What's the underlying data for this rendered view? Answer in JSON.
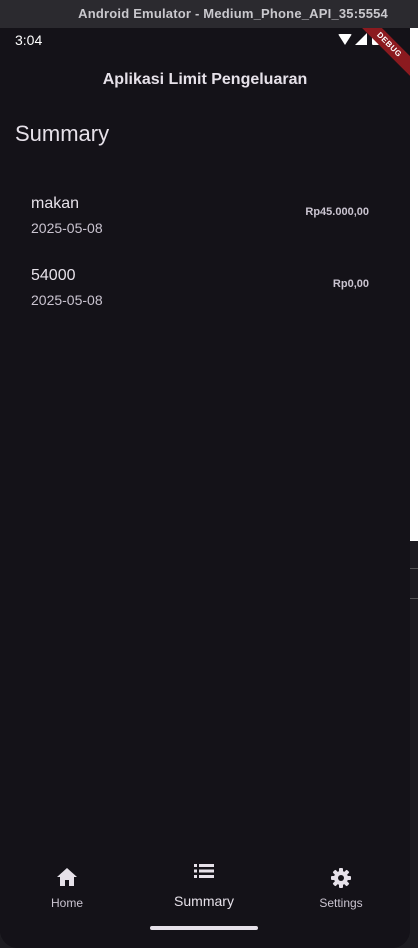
{
  "window": {
    "title": "Android Emulator - Medium_Phone_API_35:5554"
  },
  "status_bar": {
    "time": "3:04",
    "icons": [
      "wifi-icon",
      "signal-icon",
      "battery-icon"
    ],
    "debug_banner": "DEBUG"
  },
  "app_bar": {
    "title": "Aplikasi Limit Pengeluaran"
  },
  "page": {
    "heading": "Summary"
  },
  "expenses": [
    {
      "title": "makan",
      "date": "2025-05-08",
      "amount": "Rp45.000,00"
    },
    {
      "title": "54000",
      "date": "2025-05-08",
      "amount": "Rp0,00"
    }
  ],
  "bottom_nav": {
    "items": [
      {
        "label": "Home",
        "icon": "home-icon",
        "selected": false
      },
      {
        "label": "Summary",
        "icon": "list-icon",
        "selected": true
      },
      {
        "label": "Settings",
        "icon": "gear-icon",
        "selected": false
      }
    ]
  },
  "colors": {
    "background": "#141218",
    "text_primary": "#e6e1e9",
    "text_secondary": "#cac4d0",
    "debug_ribbon": "#8b1a1f"
  }
}
